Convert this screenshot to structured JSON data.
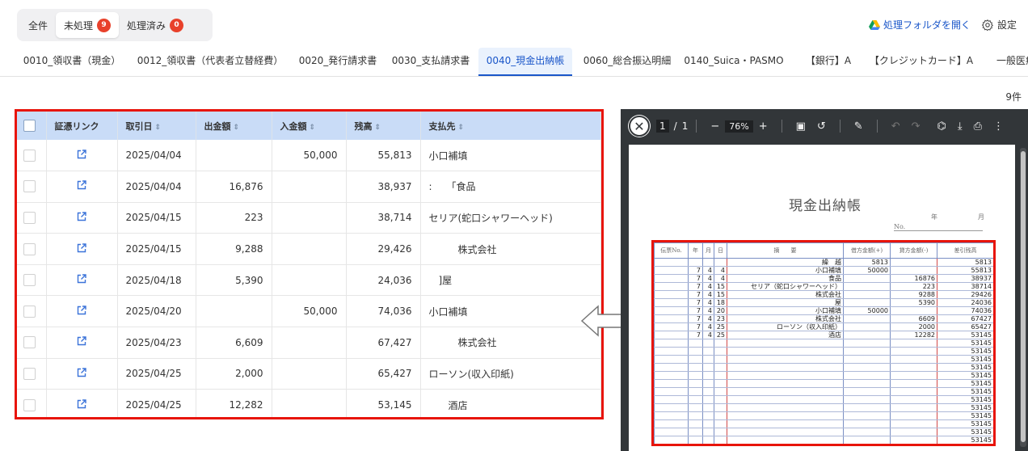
{
  "status_tabs": [
    {
      "label": "全件",
      "badge": null,
      "active": false
    },
    {
      "label": "未処理",
      "badge": "9",
      "active": true
    },
    {
      "label": "処理済み",
      "badge": "0",
      "active": false
    }
  ],
  "header": {
    "open_folder_label": "処理フォルダを開く",
    "settings_label": "設定"
  },
  "category_tabs": [
    {
      "label": "0010_領収書（現金）",
      "active": false
    },
    {
      "label": "0012_領収書（代表者立替経費）",
      "active": false
    },
    {
      "label": "0020_発行請求書",
      "active": false
    },
    {
      "label": "0030_支払請求書",
      "active": false
    },
    {
      "label": "0040_現金出納帳",
      "active": true
    },
    {
      "label": "0060_総合振込明細",
      "active": false
    },
    {
      "label": "0140_Suica・PASMO",
      "active": false
    },
    {
      "label": "【銀行】A",
      "active": false
    },
    {
      "label": "【クレジットカード】A",
      "active": false
    },
    {
      "label": "一般医療",
      "active": false
    }
  ],
  "count_label": "9件",
  "table": {
    "columns": [
      "証憑リンク",
      "取引日",
      "出金額",
      "入金額",
      "残高",
      "支払先"
    ],
    "rows": [
      {
        "date": "2025/04/04",
        "out": "",
        "in": "50,000",
        "balance": "55,813",
        "payee": "小口補填"
      },
      {
        "date": "2025/04/04",
        "out": "16,876",
        "in": "",
        "balance": "38,937",
        "payee": ":　　「食品"
      },
      {
        "date": "2025/04/15",
        "out": "223",
        "in": "",
        "balance": "38,714",
        "payee": "セリア(蛇口シャワーヘッド)"
      },
      {
        "date": "2025/04/15",
        "out": "9,288",
        "in": "",
        "balance": "29,426",
        "payee": "　　　株式会社"
      },
      {
        "date": "2025/04/18",
        "out": "5,390",
        "in": "",
        "balance": "24,036",
        "payee": "　]屋"
      },
      {
        "date": "2025/04/20",
        "out": "",
        "in": "50,000",
        "balance": "74,036",
        "payee": "小口補填"
      },
      {
        "date": "2025/04/23",
        "out": "6,609",
        "in": "",
        "balance": "67,427",
        "payee": "　　　株式会社"
      },
      {
        "date": "2025/04/25",
        "out": "2,000",
        "in": "",
        "balance": "65,427",
        "payee": "ローソン(収入印紙)"
      },
      {
        "date": "2025/04/25",
        "out": "12,282",
        "in": "",
        "balance": "53,145",
        "payee": "　　酒店"
      }
    ]
  },
  "viewer": {
    "page": "1",
    "page_sep": "/",
    "total": "1",
    "zoom": "76%"
  },
  "document": {
    "title": "現金出納帳",
    "year_label": "年",
    "month_label": "月",
    "no_label": "No.",
    "headers": [
      "伝票No.",
      "年",
      "月",
      "日",
      "摘　　要",
      "借方金額(+)",
      "貸方金額(-)",
      "差引残高"
    ],
    "rows": [
      {
        "y": "",
        "m": "",
        "d": "",
        "desc": "繰　越",
        "debit": "5813",
        "credit": "",
        "balance": "5813"
      },
      {
        "y": "7",
        "m": "4",
        "d": "4",
        "desc": "小口補填",
        "debit": "50000",
        "credit": "",
        "balance": "55813"
      },
      {
        "y": "7",
        "m": "4",
        "d": "4",
        "desc": "食品",
        "debit": "",
        "credit": "16876",
        "balance": "38937"
      },
      {
        "y": "7",
        "m": "4",
        "d": "15",
        "desc": "セリア（蛇口シャワーヘッド）",
        "debit": "",
        "credit": "223",
        "balance": "38714"
      },
      {
        "y": "7",
        "m": "4",
        "d": "15",
        "desc": "株式会社",
        "debit": "",
        "credit": "9288",
        "balance": "29426"
      },
      {
        "y": "7",
        "m": "4",
        "d": "18",
        "desc": "屋",
        "debit": "",
        "credit": "5390",
        "balance": "24036"
      },
      {
        "y": "7",
        "m": "4",
        "d": "20",
        "desc": "小口補填",
        "debit": "50000",
        "credit": "",
        "balance": "74036"
      },
      {
        "y": "7",
        "m": "4",
        "d": "23",
        "desc": "株式会社",
        "debit": "",
        "credit": "6609",
        "balance": "67427"
      },
      {
        "y": "7",
        "m": "4",
        "d": "25",
        "desc": "ローソン（収入印紙）",
        "debit": "",
        "credit": "2000",
        "balance": "65427"
      },
      {
        "y": "7",
        "m": "4",
        "d": "25",
        "desc": "酒店",
        "debit": "",
        "credit": "12282",
        "balance": "53145"
      },
      {
        "y": "",
        "m": "",
        "d": "",
        "desc": "",
        "debit": "",
        "credit": "",
        "balance": "53145"
      },
      {
        "y": "",
        "m": "",
        "d": "",
        "desc": "",
        "debit": "",
        "credit": "",
        "balance": "53145"
      },
      {
        "y": "",
        "m": "",
        "d": "",
        "desc": "",
        "debit": "",
        "credit": "",
        "balance": "53145"
      },
      {
        "y": "",
        "m": "",
        "d": "",
        "desc": "",
        "debit": "",
        "credit": "",
        "balance": "53145"
      },
      {
        "y": "",
        "m": "",
        "d": "",
        "desc": "",
        "debit": "",
        "credit": "",
        "balance": "53145"
      },
      {
        "y": "",
        "m": "",
        "d": "",
        "desc": "",
        "debit": "",
        "credit": "",
        "balance": "53145"
      },
      {
        "y": "",
        "m": "",
        "d": "",
        "desc": "",
        "debit": "",
        "credit": "",
        "balance": "53145"
      },
      {
        "y": "",
        "m": "",
        "d": "",
        "desc": "",
        "debit": "",
        "credit": "",
        "balance": "53145"
      },
      {
        "y": "",
        "m": "",
        "d": "",
        "desc": "",
        "debit": "",
        "credit": "",
        "balance": "53145"
      },
      {
        "y": "",
        "m": "",
        "d": "",
        "desc": "",
        "debit": "",
        "credit": "",
        "balance": "53145"
      },
      {
        "y": "",
        "m": "",
        "d": "",
        "desc": "",
        "debit": "",
        "credit": "",
        "balance": "53145"
      },
      {
        "y": "",
        "m": "",
        "d": "",
        "desc": "",
        "debit": "",
        "credit": "",
        "balance": "53145"
      },
      {
        "y": "",
        "m": "",
        "d": "",
        "desc": "",
        "debit": "",
        "credit": "",
        "balance": "53145"
      }
    ]
  },
  "colors": {
    "accent": "#1a56c9",
    "highlight_border": "#e8140a",
    "badge": "#e8412b",
    "table_header": "#c9dcf7",
    "viewer_bg": "#323639"
  }
}
